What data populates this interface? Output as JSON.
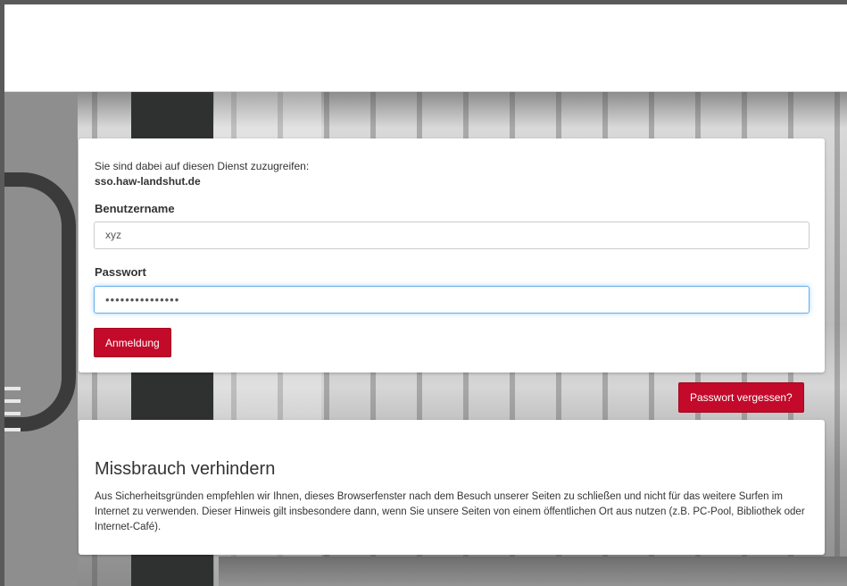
{
  "login": {
    "intro_text": "Sie sind dabei auf diesen Dienst zuzugreifen:",
    "service": "sso.haw-landshut.de",
    "username_label": "Benutzername",
    "username_value": "xyz",
    "password_label": "Passwort",
    "password_value": "•••••••••••••••",
    "login_button": "Anmeldung"
  },
  "forgot_password_button": "Passwort vergessen?",
  "info": {
    "title": "Missbrauch verhindern",
    "text": "Aus Sicherheitsgründen empfehlen wir Ihnen, dieses Browserfenster nach dem Besuch unserer Seiten zu schließen und nicht für das weitere Surfen im Internet zu verwenden. Dieser Hinweis gilt insbesondere dann, wenn Sie unsere Seiten von einem öffentlichen Ort aus nutzen (z.B. PC-Pool, Bibliothek oder Internet-Café)."
  },
  "colors": {
    "accent": "#c30a2a",
    "focus_border": "#66afe9"
  }
}
